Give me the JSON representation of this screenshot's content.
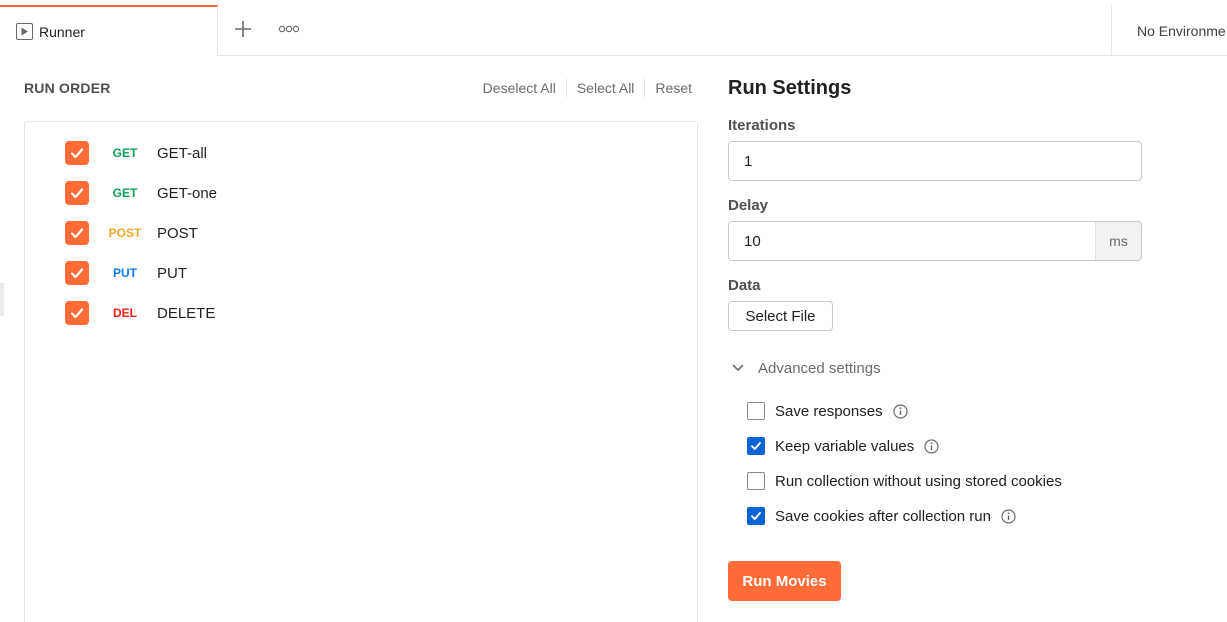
{
  "tabs": {
    "runner_label": "Runner",
    "plus_icon": "plus-icon",
    "more_icon": "more-horizontal-icon",
    "environment_label": "No Environme"
  },
  "run_order": {
    "title": "RUN ORDER",
    "actions": [
      "Deselect All",
      "Select All",
      "Reset"
    ],
    "requests": [
      {
        "method": "GET",
        "name": "GET-all",
        "checked": true,
        "method_color": "#0f9d58"
      },
      {
        "method": "GET",
        "name": "GET-one",
        "checked": true,
        "method_color": "#0f9d58"
      },
      {
        "method": "POST",
        "name": "POST",
        "checked": true,
        "method_color": "#f4a62a"
      },
      {
        "method": "PUT",
        "name": "PUT",
        "checked": true,
        "method_color": "#097bed"
      },
      {
        "method": "DEL",
        "name": "DELETE",
        "checked": true,
        "method_color": "#eb2013"
      }
    ]
  },
  "settings": {
    "title": "Run Settings",
    "iterations_label": "Iterations",
    "iterations_value": "1",
    "delay_label": "Delay",
    "delay_value": "10",
    "delay_unit": "ms",
    "data_label": "Data",
    "select_file_label": "Select File",
    "advanced_label": "Advanced settings",
    "options": [
      {
        "label": "Save responses",
        "checked": false,
        "info": true
      },
      {
        "label": "Keep variable values",
        "checked": true,
        "info": true
      },
      {
        "label": "Run collection without using stored cookies",
        "checked": false,
        "info": false
      },
      {
        "label": "Save cookies after collection run",
        "checked": true,
        "info": true
      }
    ],
    "run_button_label": "Run Movies"
  },
  "colors": {
    "accent": "#ff6c37",
    "checkbox_blue": "#0b63d6"
  }
}
